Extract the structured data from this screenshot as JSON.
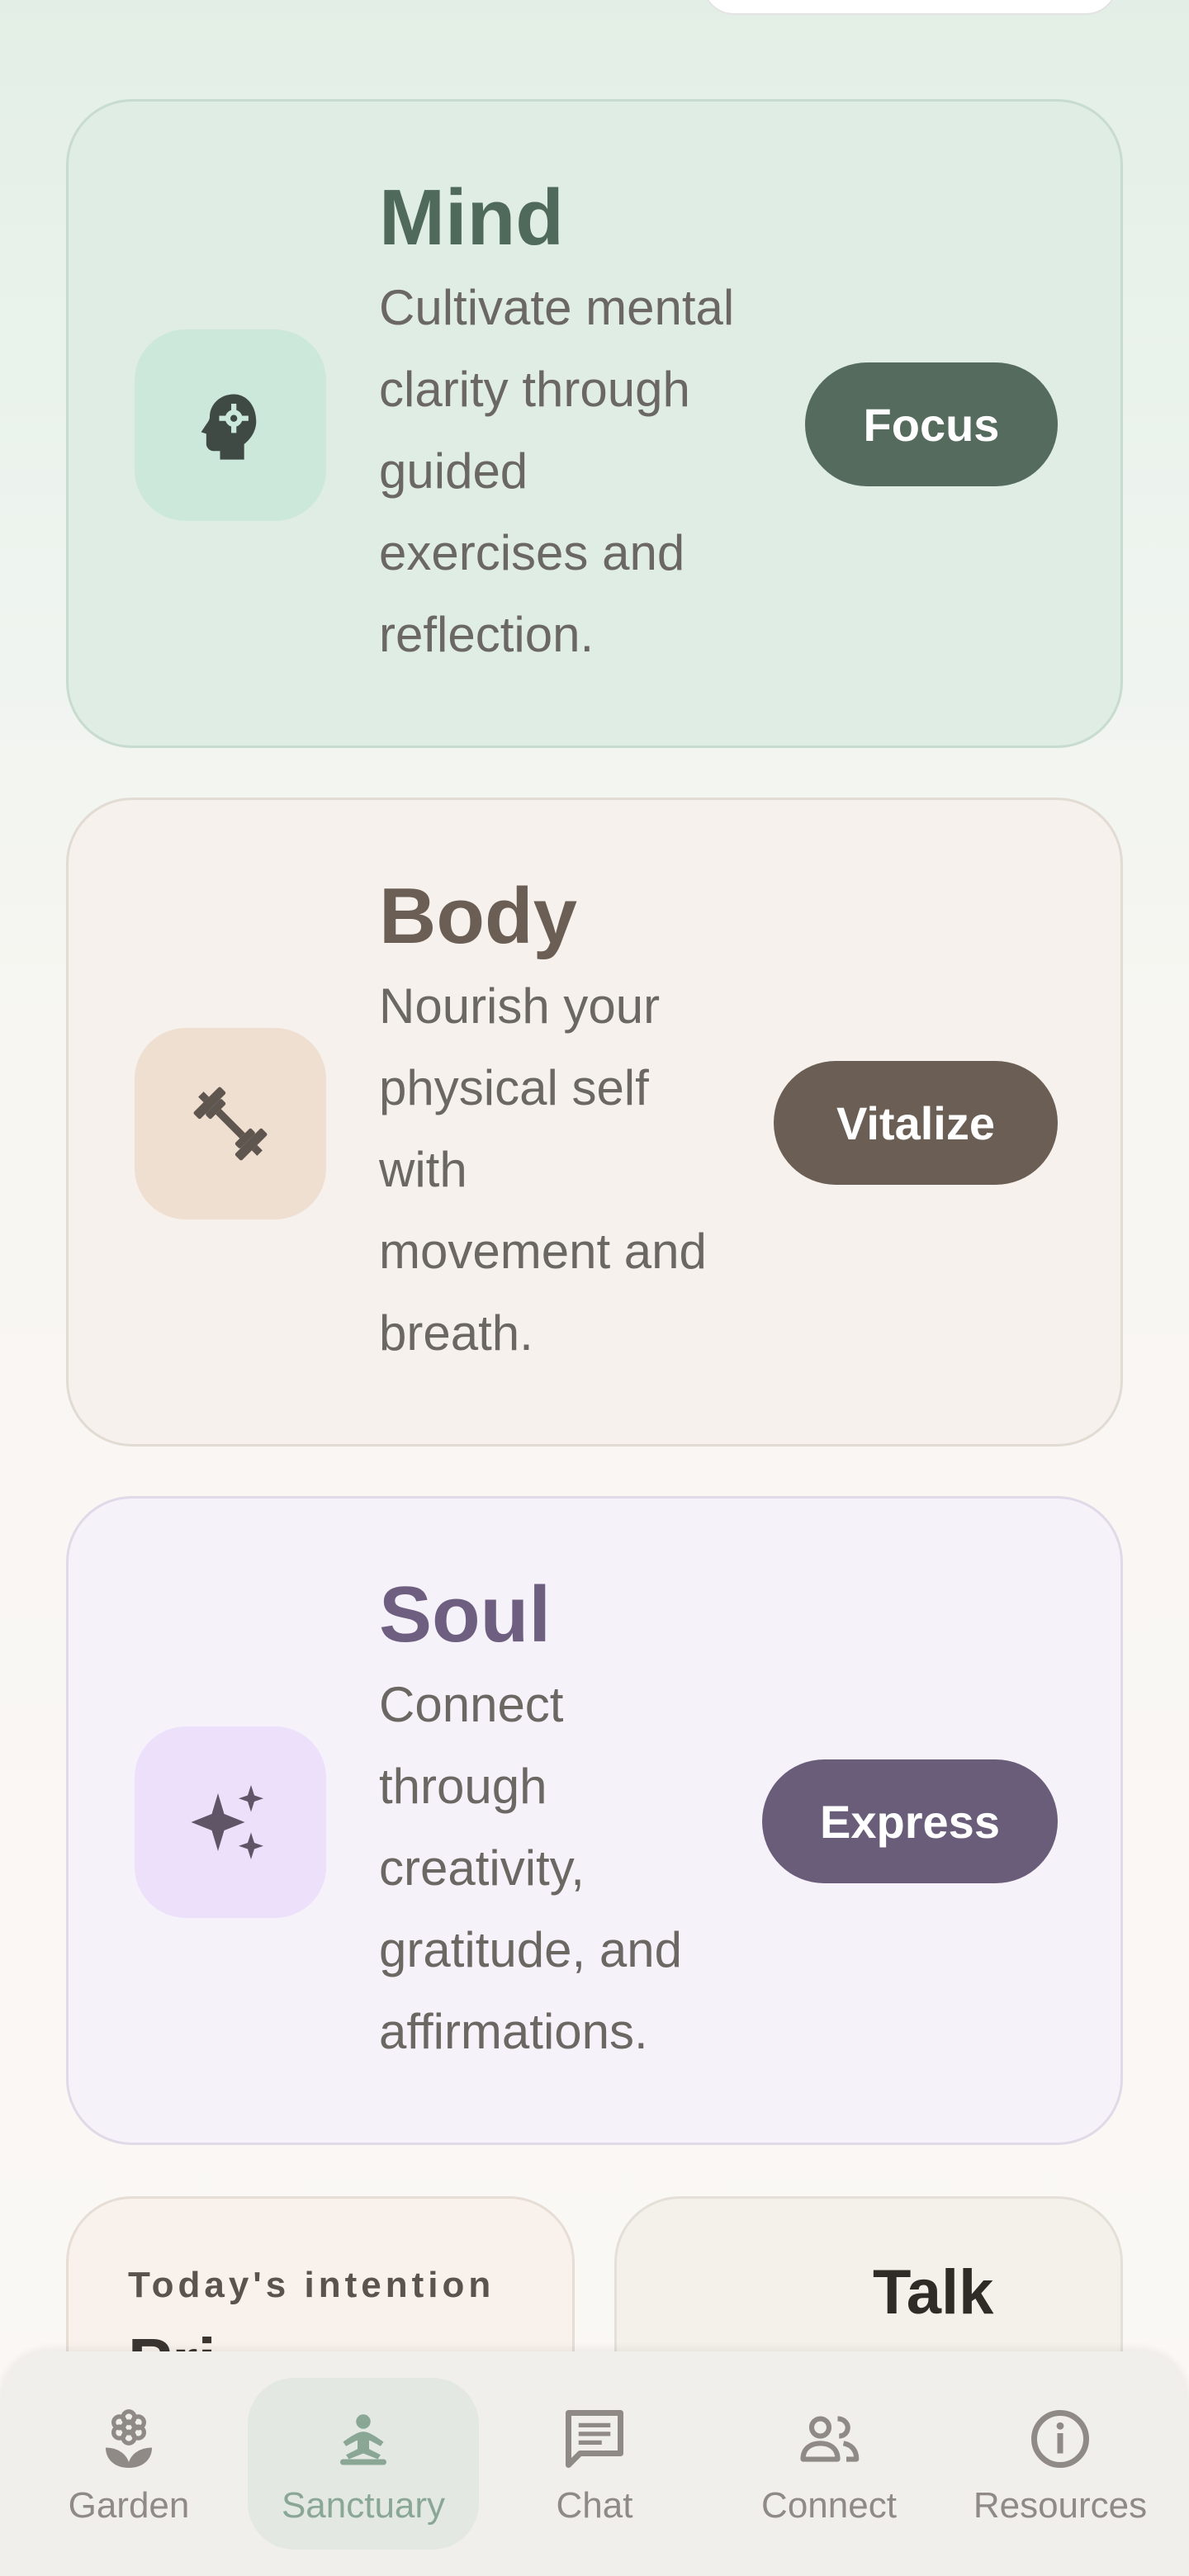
{
  "cards": [
    {
      "id": "mind",
      "title": "Mind",
      "description": "Cultivate mental clarity through guided exercises and reflection.",
      "button": "Focus",
      "icon": "psychology-head-gear-icon"
    },
    {
      "id": "body",
      "title": "Body",
      "description": "Nourish your physical self with movement and breath.",
      "button": "Vitalize",
      "icon": "dumbbell-icon"
    },
    {
      "id": "soul",
      "title": "Soul",
      "description": "Connect through creativity, gratitude, and affirmations.",
      "button": "Express",
      "icon": "sparkles-icon"
    }
  ],
  "intention": {
    "label": "Today's intention",
    "value": "Pri..."
  },
  "talk": {
    "label": "Talk"
  },
  "nav": {
    "items": [
      {
        "label": "Garden",
        "icon": "flower-icon",
        "active": false
      },
      {
        "label": "Sanctuary",
        "icon": "meditation-icon",
        "active": true
      },
      {
        "label": "Chat",
        "icon": "chat-icon",
        "active": false
      },
      {
        "label": "Connect",
        "icon": "people-icon",
        "active": false
      },
      {
        "label": "Resources",
        "icon": "info-icon",
        "active": false
      }
    ]
  },
  "colors": {
    "mind_accent": "#546b5d",
    "body_accent": "#6b5f55",
    "soul_accent": "#6a5d7a",
    "nav_active": "#8aa796"
  }
}
